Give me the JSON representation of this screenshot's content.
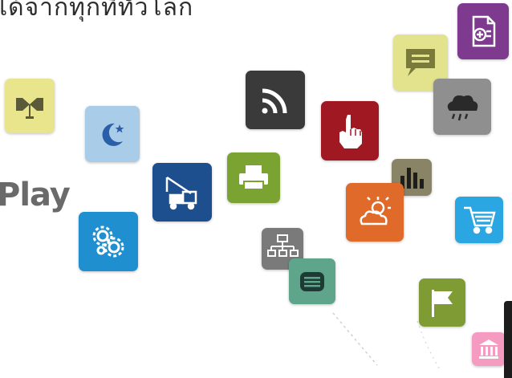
{
  "headline": "ได้จากทุกที่ทั่วโลก",
  "store_label": "Play",
  "icons": [
    {
      "name": "flag-corner-icon",
      "color": "#e9e58c"
    },
    {
      "name": "moon-stars-icon",
      "color": "#a9cce8"
    },
    {
      "name": "settings-gears-icon",
      "color": "#1f8fcf"
    },
    {
      "name": "crane-truck-icon",
      "color": "#1d4f8e"
    },
    {
      "name": "rss-feed-icon",
      "color": "#3a3a3a"
    },
    {
      "name": "printer-icon",
      "color": "#7aa332"
    },
    {
      "name": "sitemap-icon",
      "color": "#7a7a7a"
    },
    {
      "name": "keyboard-icon",
      "color": "#5ea58c"
    },
    {
      "name": "hand-pointer-icon",
      "color": "#a01822"
    },
    {
      "name": "bar-chart-icon",
      "color": "#8a8466"
    },
    {
      "name": "weather-sun-cloud-icon",
      "color": "#e06a2a"
    },
    {
      "name": "chat-bubble-icon",
      "color": "#e3e38e"
    },
    {
      "name": "rain-cloud-icon",
      "color": "#8f8f8f"
    },
    {
      "name": "add-document-icon",
      "color": "#7d3a8f"
    },
    {
      "name": "shopping-cart-icon",
      "color": "#2aa7e3"
    },
    {
      "name": "white-flag-icon",
      "color": "#7f9c34"
    },
    {
      "name": "bank-icon",
      "color": "#f59ac0"
    }
  ]
}
